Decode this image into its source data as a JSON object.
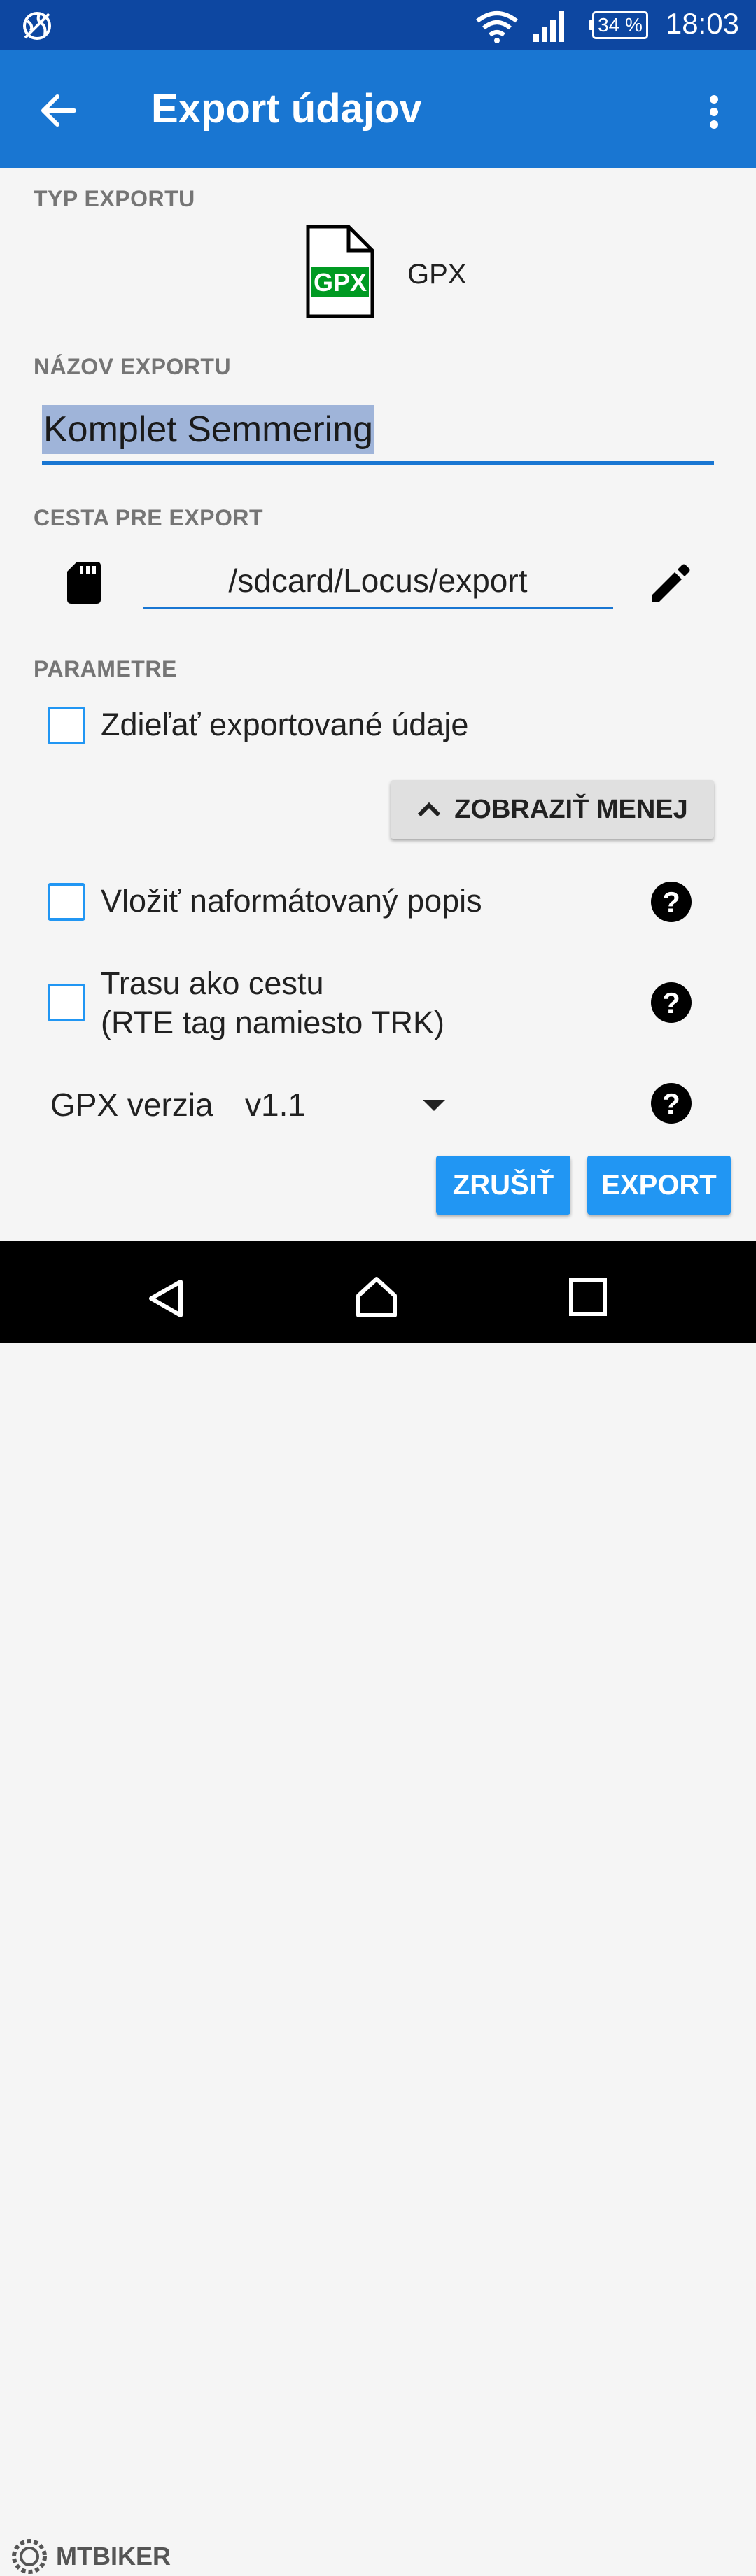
{
  "status_bar": {
    "time": "18:03",
    "battery": "34 %"
  },
  "app_bar": {
    "title": "Export údajov"
  },
  "export_type": {
    "section_label": "TYP EXPORTU",
    "file_icon_text": "GPX",
    "type_label": "GPX"
  },
  "export_name": {
    "section_label": "NÁZOV EXPORTU",
    "value": "Komplet Semmering"
  },
  "export_path": {
    "section_label": "CESTA PRE EXPORT",
    "value": "/sdcard/Locus/export"
  },
  "parameters": {
    "section_label": "PARAMETRE",
    "share_label": "Zdieľať exportované údaje",
    "show_less_label": "ZOBRAZIŤ MENEJ",
    "formatted_description_label": "Vložiť naformátovaný popis",
    "route_line1": "Trasu ako cestu",
    "route_line2": "(RTE tag namiesto TRK)",
    "gpx_version_label": "GPX verzia",
    "gpx_version_value": "v1.1"
  },
  "actions": {
    "cancel_label": "ZRUŠIŤ",
    "export_label": "EXPORT"
  },
  "watermark": {
    "text": "MTBIKER"
  },
  "colors": {
    "status_bar": "#0d47a1",
    "app_bar": "#1976d2",
    "accent": "#2196f3",
    "gpx_green": "#009a22"
  }
}
